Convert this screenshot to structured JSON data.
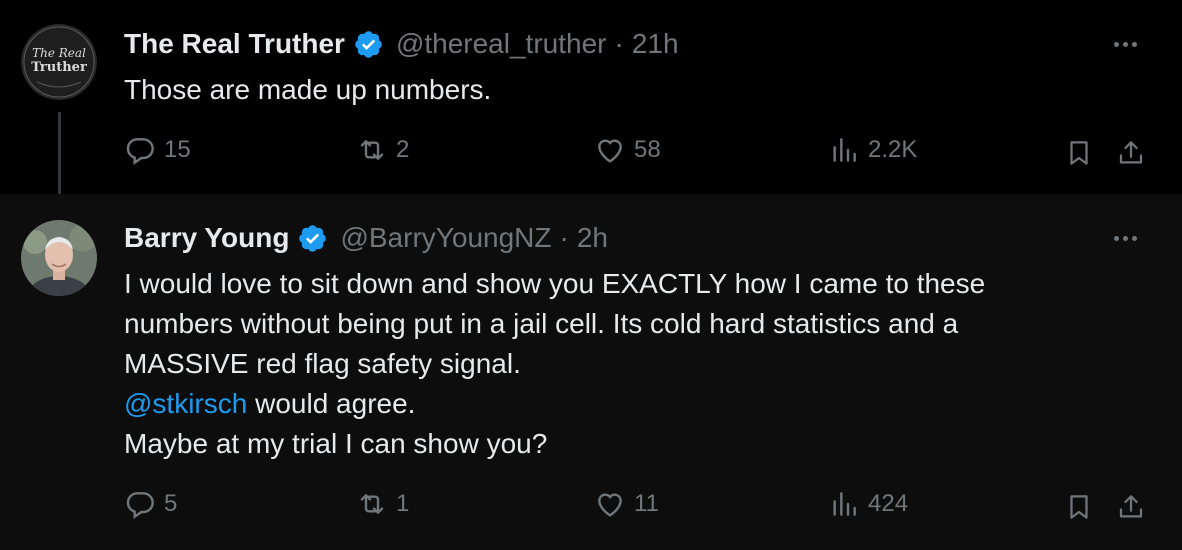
{
  "tweets": [
    {
      "avatar_text": [
        "The Real",
        "Truther"
      ],
      "name": "The Real Truther",
      "handle": "@thereal_truther",
      "separator": "·",
      "time": "21h",
      "text_lines": [
        "Those are made up numbers."
      ],
      "replies": "15",
      "retweets": "2",
      "likes": "58",
      "views": "2.2K"
    },
    {
      "name": "Barry Young",
      "handle": "@BarryYoungNZ",
      "separator": "·",
      "time": "2h",
      "text_lines": [
        "I would love to sit down and show you EXACTLY how I came to these",
        "numbers without being put in a jail cell.  Its cold hard statistics and a",
        "MASSIVE red flag safety signal."
      ],
      "mention": "@stkirsch",
      "mention_suffix": " would agree.",
      "last_line": "Maybe at my trial I can show you?",
      "replies": "5",
      "retweets": "1",
      "likes": "11",
      "views": "424"
    }
  ],
  "colors": {
    "accent": "#1d9bf0",
    "muted": "#71767b",
    "text": "#e7e9ea"
  },
  "icons": [
    "reply-icon",
    "retweet-icon",
    "like-icon",
    "views-icon",
    "bookmark-icon",
    "share-icon",
    "verified-badge-icon",
    "more-icon"
  ]
}
